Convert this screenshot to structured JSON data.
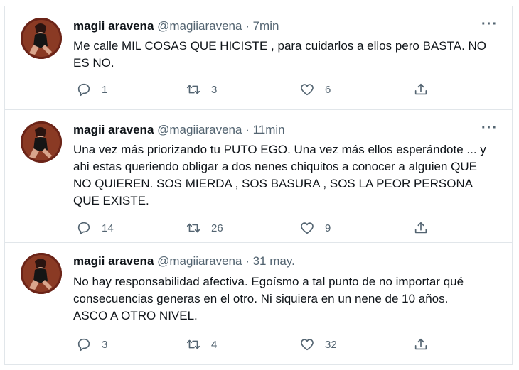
{
  "tweets": [
    {
      "name": "magii aravena",
      "handle": "@magiiaravena",
      "time": "· 7min",
      "lines": [
        "Me calle MIL COSAS QUE HICISTE , para cuidarlos a ellos pero BASTA. NO",
        "ES NO."
      ],
      "replies": "1",
      "retweets": "3",
      "likes": "6"
    },
    {
      "name": "magii aravena",
      "handle": "@magiiaravena",
      "time": "· 11min",
      "lines": [
        "Una vez más priorizando tu PUTO EGO. Una vez más ellos esperándote  ... y",
        "ahi estas queriendo obligar a dos nenes chiquitos a conocer a alguien QUE",
        "NO QUIEREN. SOS MIERDA , SOS BASURA , SOS LA  PEOR PERSONA",
        "QUE EXISTE."
      ],
      "replies": "14",
      "retweets": "26",
      "likes": "9"
    },
    {
      "name": "magii aravena",
      "handle": "@magiiaravena",
      "time": "· 31 may.",
      "lines": [
        "No hay responsabilidad afectiva. Egoísmo a tal punto de no importar qué",
        "consecuencias generas en el otro.  Ni siquiera en un nene de 10 años.",
        "ASCO A OTRO NIVEL."
      ],
      "replies": "3",
      "retweets": "4",
      "likes": "32"
    }
  ],
  "icons": {
    "more": "more-icon",
    "reply": "reply-icon",
    "retweet": "retweet-icon",
    "like": "like-icon",
    "share": "share-icon"
  },
  "colors": {
    "text": "#0f1419",
    "muted": "#536471",
    "border": "#e1e6ea"
  }
}
